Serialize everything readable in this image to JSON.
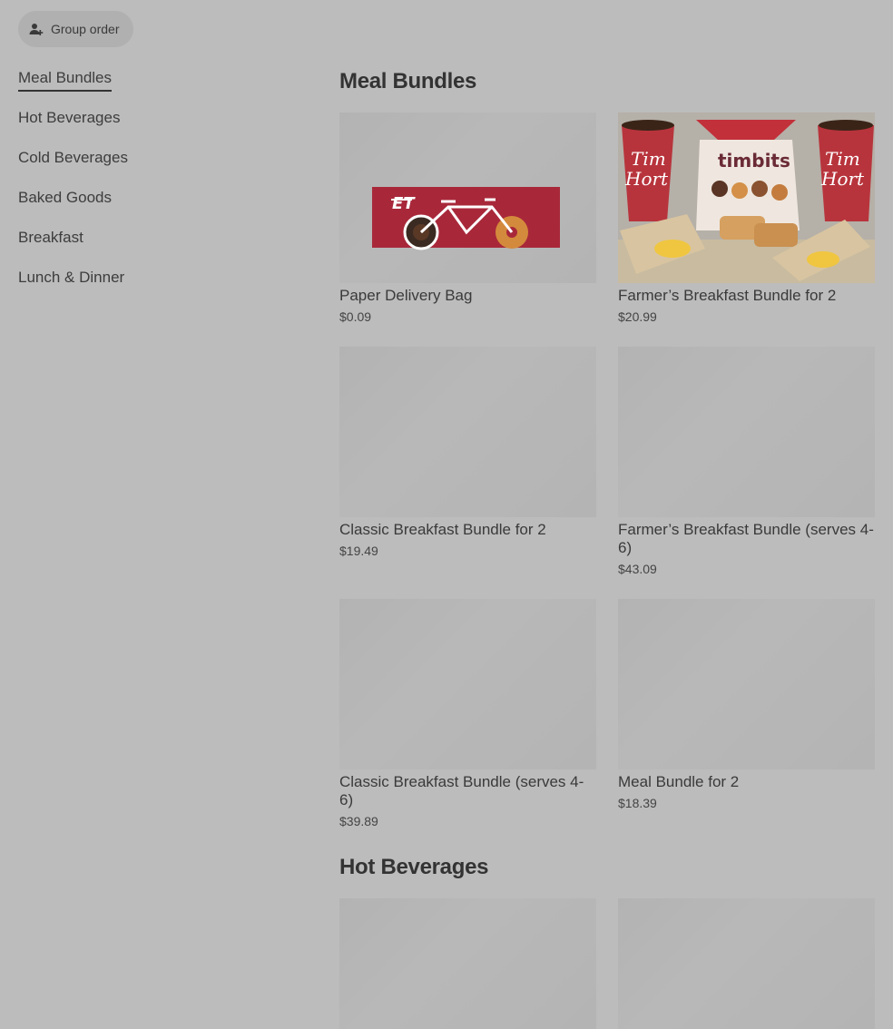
{
  "group_order": {
    "label": "Group order",
    "icon": "add-person-icon"
  },
  "sidebar": {
    "items": [
      {
        "label": "Meal Bundles",
        "active": true
      },
      {
        "label": "Hot Beverages",
        "active": false
      },
      {
        "label": "Cold Beverages",
        "active": false
      },
      {
        "label": "Baked Goods",
        "active": false
      },
      {
        "label": "Breakfast",
        "active": false
      },
      {
        "label": "Lunch & Dinner",
        "active": false
      }
    ]
  },
  "sections": [
    {
      "title": "Meal Bundles",
      "items": [
        {
          "name": "Paper Delivery Bag",
          "price": "$0.09",
          "image": "delivery-bag-image"
        },
        {
          "name": "Farmer’s Breakfast Bundle for 2",
          "price": "$20.99",
          "image": "bundle-photo",
          "image_text": "Tim Hortons timbits"
        },
        {
          "name": "Classic Breakfast Bundle for 2",
          "price": "$19.49",
          "image": "placeholder"
        },
        {
          "name": "Farmer’s Breakfast Bundle (serves 4-6)",
          "price": "$43.09",
          "image": "placeholder"
        },
        {
          "name": "Classic Breakfast Bundle (serves 4-6)",
          "price": "$39.89",
          "image": "placeholder"
        },
        {
          "name": "Meal Bundle for 2",
          "price": "$18.39",
          "image": "placeholder"
        }
      ]
    },
    {
      "title": "Hot Beverages",
      "items": [
        {
          "image": "placeholder"
        },
        {
          "image": "placeholder"
        }
      ]
    }
  ],
  "colors": {
    "background": "#bcbcbc",
    "text": "#3a3a3a",
    "brand_red": "#a8283a"
  }
}
